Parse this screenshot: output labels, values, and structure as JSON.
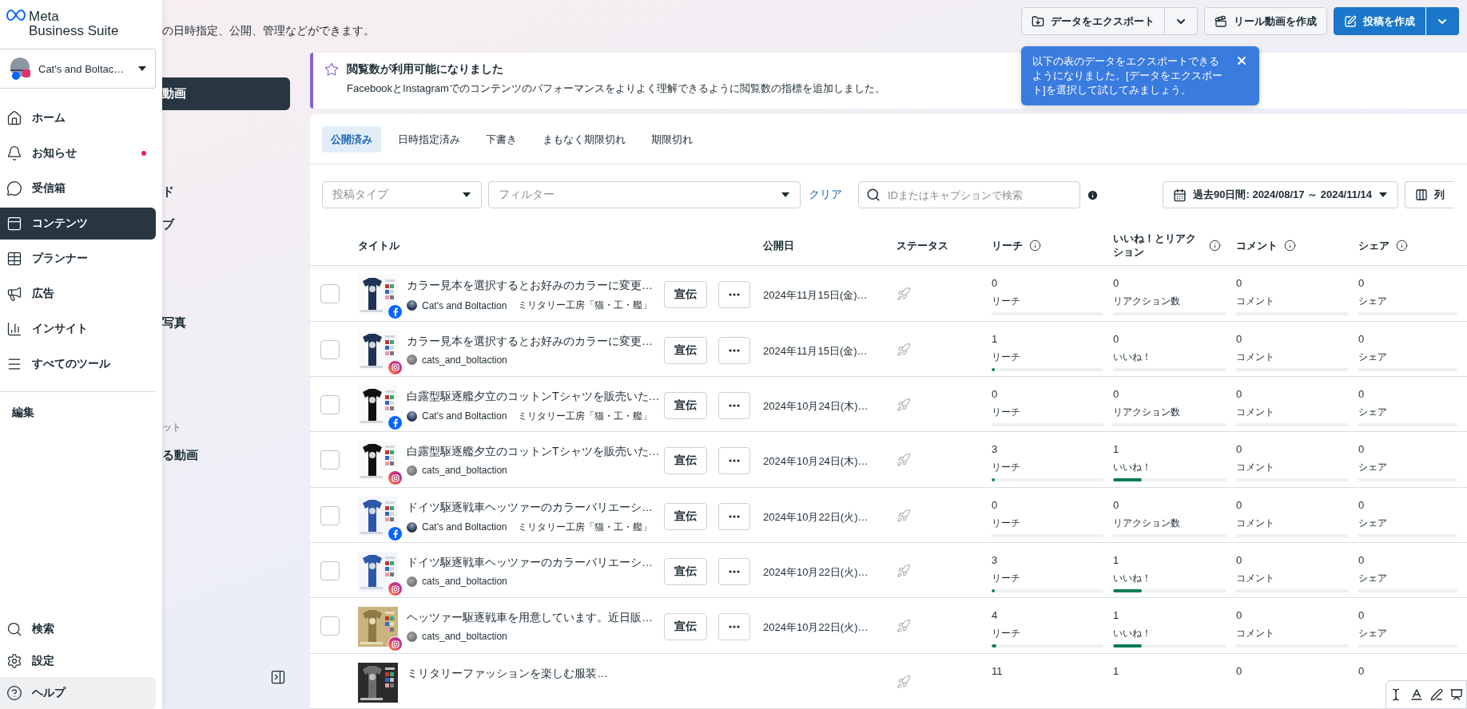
{
  "logo": {
    "line1": "Meta",
    "line2": "Business Suite"
  },
  "account": {
    "name": "Cat's and Boltac…"
  },
  "nav": [
    {
      "label": "ホーム",
      "selected": false,
      "dot": false
    },
    {
      "label": "お知らせ",
      "selected": false,
      "dot": true
    },
    {
      "label": "受信箱",
      "selected": false,
      "dot": false
    },
    {
      "label": "コンテンツ",
      "selected": true,
      "dot": false
    },
    {
      "label": "プランナー",
      "selected": false,
      "dot": false
    },
    {
      "label": "広告",
      "selected": false,
      "dot": false
    },
    {
      "label": "インサイト",
      "selected": false,
      "dot": false
    },
    {
      "label": "すべてのツール",
      "selected": false,
      "dot": false
    }
  ],
  "edit_label": "編集",
  "nav_bottom": [
    {
      "label": "検索",
      "selected": false
    },
    {
      "label": "設定",
      "selected": false
    },
    {
      "label": "ヘルプ",
      "selected": true
    }
  ],
  "subtitle": "の日時指定、公開、管理などができます。",
  "subnav": {
    "groups": [
      [
        {
          "label": "動画",
          "kind": "item",
          "selected": true
        }
      ],
      [
        {
          "label": "ド",
          "kind": "item",
          "selected": false
        },
        {
          "label": "ブ",
          "kind": "item",
          "selected": false
        }
      ],
      [
        {
          "label": "写真",
          "kind": "item",
          "selected": false
        }
      ],
      [
        {
          "label": "ット",
          "kind": "heading"
        },
        {
          "label": "る動画",
          "kind": "item",
          "selected": false
        }
      ]
    ]
  },
  "header_buttons": {
    "export": "データをエクスポート",
    "reel": "リール動画を作成",
    "create": "投稿を作成"
  },
  "tooltip": {
    "text": "以下の表のデータをエクスポートできるようになりました。[データをエクスポート]を選択して試してみましょう。"
  },
  "banner": {
    "title": "閲覧数が利用可能になりました",
    "body": "FacebookとInstagramでのコンテンツのパフォーマンスをよりよく理解できるように閲覧数の指標を追加しました。"
  },
  "tabs": [
    {
      "label": "公開済み",
      "selected": true
    },
    {
      "label": "日時指定済み",
      "selected": false
    },
    {
      "label": "下書き",
      "selected": false
    },
    {
      "label": "まもなく期限切れ",
      "selected": false
    },
    {
      "label": "期限切れ",
      "selected": false
    }
  ],
  "filters": {
    "post_type": {
      "placeholder": "投稿タイプ"
    },
    "filter": {
      "placeholder": "フィルター"
    },
    "clear": "クリア",
    "search": {
      "placeholder": "IDまたはキャプションで検索"
    },
    "date_range": "過去90日間: 2024/08/17 ～ 2024/11/14",
    "columns": "列"
  },
  "table": {
    "columns": [
      {
        "label": "タイトル",
        "info": false
      },
      {
        "label": "公開日",
        "info": false
      },
      {
        "label": "ステータス",
        "info": false
      },
      {
        "label": "リーチ",
        "info": true
      },
      {
        "label": "いいね！とリアクション",
        "info": true
      },
      {
        "label": "コメント",
        "info": true
      },
      {
        "label": "シェア",
        "info": true
      }
    ],
    "rows": [
      {
        "kind": "facebook",
        "checked": false,
        "title": "カラー見本を選択するとお好みのカラーに変更…",
        "account": "Cat's and Boltaction",
        "page": "ミリタリー工房「猫・工・艦」",
        "promote": "宣伝",
        "date": "2024年11月15日(金)…",
        "metrics": [
          {
            "value": "0",
            "label": "リーチ",
            "level": 0
          },
          {
            "value": "0",
            "label": "リアクション数",
            "level": 0
          },
          {
            "value": "0",
            "label": "コメント",
            "level": 0
          },
          {
            "value": "0",
            "label": "シェア",
            "level": 0
          }
        ]
      },
      {
        "kind": "instagram",
        "checked": false,
        "title": "カラー見本を選択するとお好みのカラーに変更…",
        "account": "cats_and_boltaction",
        "promote": "宣伝",
        "date": "2024年11月15日(金)…",
        "metrics": [
          {
            "value": "1",
            "label": "リーチ",
            "level": 0.015
          },
          {
            "value": "0",
            "label": "いいね！",
            "level": 0
          },
          {
            "value": "0",
            "label": "コメント",
            "level": 0
          },
          {
            "value": "0",
            "label": "シェア",
            "level": 0
          }
        ]
      },
      {
        "kind": "facebook",
        "checked": false,
        "title": "白露型駆逐艦夕立のコットンTシャツを販売いた…",
        "account": "Cat's and Boltaction",
        "page": "ミリタリー工房「猫・工・艦」",
        "promote": "宣伝",
        "date": "2024年10月24日(木)…",
        "metrics": [
          {
            "value": "0",
            "label": "リーチ",
            "level": 0
          },
          {
            "value": "0",
            "label": "リアクション数",
            "level": 0
          },
          {
            "value": "0",
            "label": "コメント",
            "level": 0
          },
          {
            "value": "0",
            "label": "シェア",
            "level": 0
          }
        ]
      },
      {
        "kind": "instagram",
        "checked": false,
        "title": "白露型駆逐艦夕立のコットンTシャツを販売いた…",
        "account": "cats_and_boltaction",
        "promote": "宣伝",
        "date": "2024年10月24日(木)…",
        "metrics": [
          {
            "value": "3",
            "label": "リーチ",
            "level": 0.03
          },
          {
            "value": "1",
            "label": "いいね！",
            "level": 0.25
          },
          {
            "value": "0",
            "label": "コメント",
            "level": 0
          },
          {
            "value": "0",
            "label": "シェア",
            "level": 0
          }
        ]
      },
      {
        "kind": "facebook",
        "checked": false,
        "title": "ドイツ駆逐戦車ヘッツァーのカラーバリエーシ…",
        "account": "Cat's and Boltaction",
        "page": "ミリタリー工房「猫・工・艦」",
        "promote": "宣伝",
        "date": "2024年10月22日(火)…",
        "metrics": [
          {
            "value": "0",
            "label": "リーチ",
            "level": 0
          },
          {
            "value": "0",
            "label": "リアクション数",
            "level": 0
          },
          {
            "value": "0",
            "label": "コメント",
            "level": 0
          },
          {
            "value": "0",
            "label": "シェア",
            "level": 0
          }
        ]
      },
      {
        "kind": "instagram",
        "checked": false,
        "title": "ドイツ駆逐戦車ヘッツァーのカラーバリエーシ…",
        "account": "cats_and_boltaction",
        "promote": "宣伝",
        "date": "2024年10月22日(火)…",
        "metrics": [
          {
            "value": "3",
            "label": "リーチ",
            "level": 0.03
          },
          {
            "value": "1",
            "label": "いいね！",
            "level": 0.25
          },
          {
            "value": "0",
            "label": "コメント",
            "level": 0
          },
          {
            "value": "0",
            "label": "シェア",
            "level": 0
          }
        ]
      },
      {
        "kind": "instagram",
        "checked": false,
        "title": "ヘッツァー駆逐戦車を用意しています。近日販…",
        "account": "cats_and_boltaction",
        "promote": "宣伝",
        "date": "2024年10月22日(火)…",
        "metrics": [
          {
            "value": "4",
            "label": "リーチ",
            "level": 0.04
          },
          {
            "value": "1",
            "label": "いいね！",
            "level": 0.25
          },
          {
            "value": "0",
            "label": "コメント",
            "level": 0
          },
          {
            "value": "0",
            "label": "シェア",
            "level": 0
          }
        ]
      },
      {
        "kind": "partial",
        "title": "ミリタリーファッションを楽しむ服装…",
        "metrics": [
          {
            "value": "11"
          },
          {
            "value": "1"
          },
          {
            "value": "0"
          },
          {
            "value": "0"
          }
        ]
      }
    ]
  }
}
